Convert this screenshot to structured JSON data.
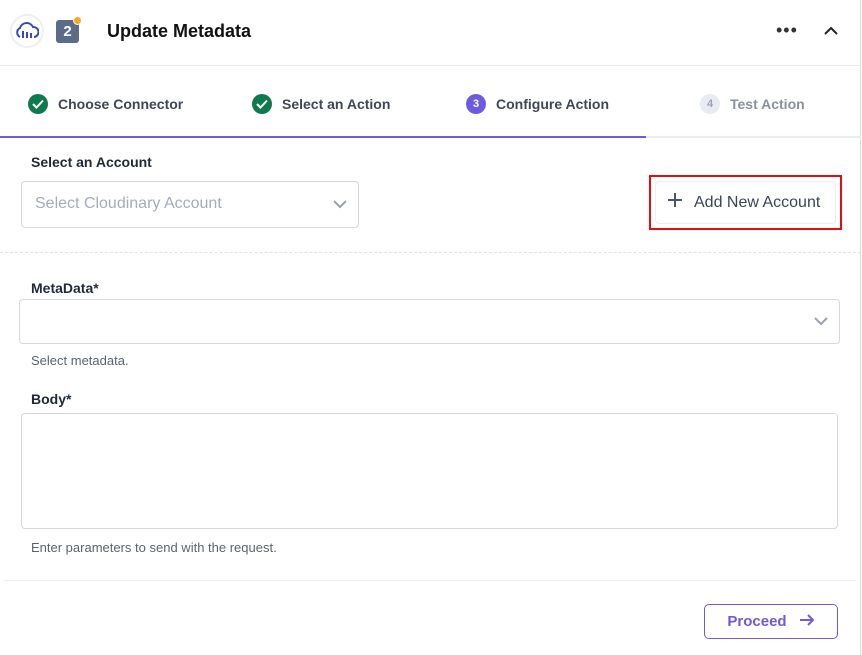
{
  "header": {
    "title": "Update Metadata",
    "step_badge": "2",
    "more_label": "•••"
  },
  "steps": [
    {
      "label": "Choose Connector",
      "status": "done"
    },
    {
      "label": "Select an Action",
      "status": "done"
    },
    {
      "number": "3",
      "label": "Configure Action",
      "status": "active"
    },
    {
      "number": "4",
      "label": "Test Action",
      "status": "pending"
    }
  ],
  "account": {
    "label": "Select an Account",
    "placeholder": "Select Cloudinary Account",
    "add_button": "Add New Account"
  },
  "metadata": {
    "label": "MetaData*",
    "value": "",
    "help": "Select metadata."
  },
  "body": {
    "label": "Body*",
    "value": "",
    "help": "Enter parameters to send with the request."
  },
  "footer": {
    "proceed": "Proceed"
  },
  "colors": {
    "accent": "#6d5ae0",
    "success": "#0f7a4f",
    "highlight": "#e01010"
  }
}
